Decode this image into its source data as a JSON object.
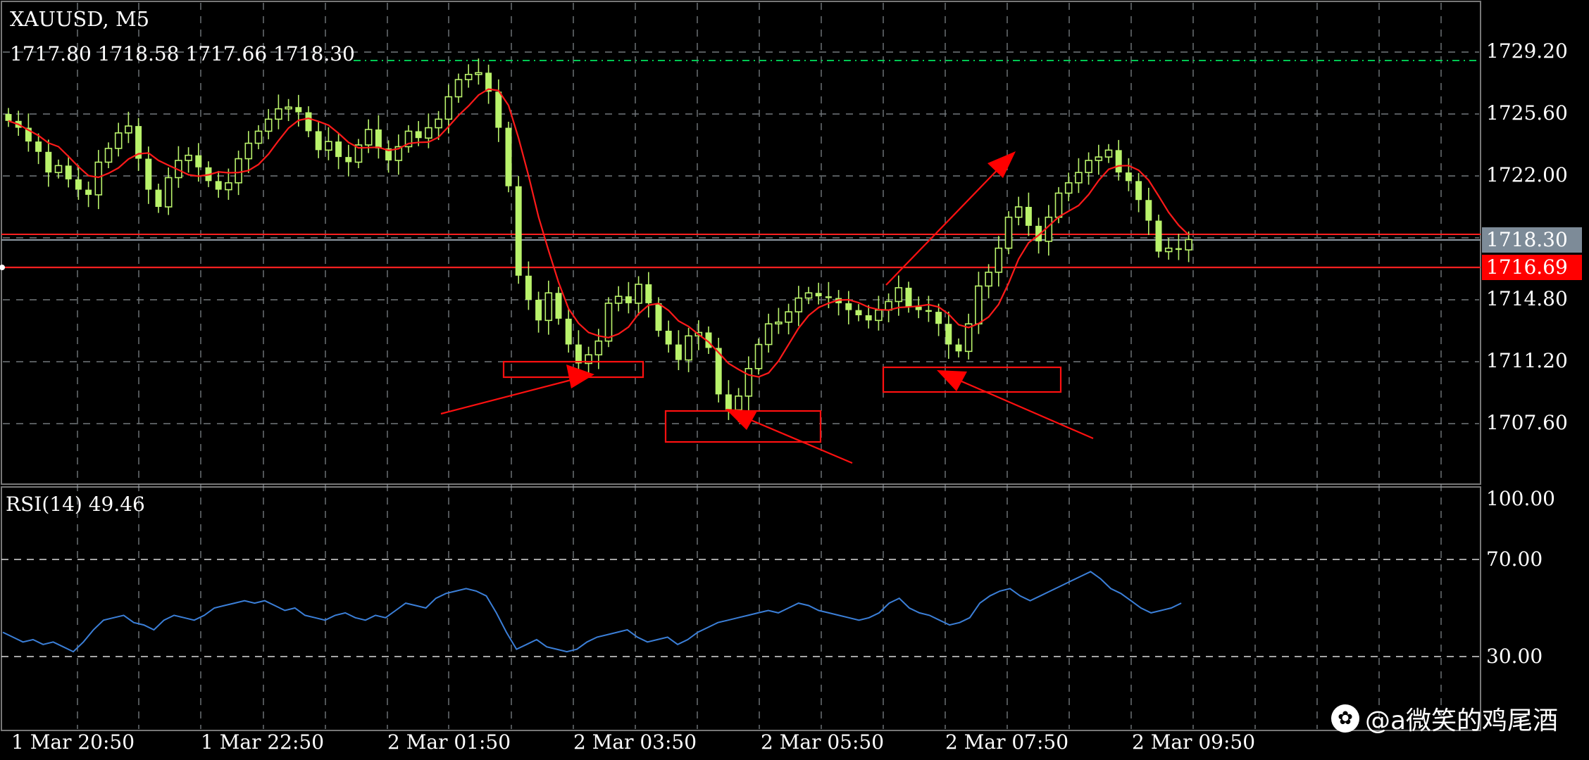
{
  "header": {
    "symbol": "XAUUSD, M5",
    "ohlc": "1717.80 1718.58 1717.66 1718.30"
  },
  "price_axis": {
    "ticks": [
      "1729.20",
      "1725.60",
      "1722.00",
      "1714.80",
      "1711.20",
      "1707.60"
    ],
    "current_price": "1718.30",
    "alert_price": "1716.69"
  },
  "rsi": {
    "title": "RSI(14) 49.46",
    "ticks": [
      "100.00",
      "70.00",
      "30.00"
    ]
  },
  "time_axis": {
    "ticks": [
      "1 Mar 20:50",
      "1 Mar 22:50",
      "2 Mar 01:50",
      "2 Mar 03:50",
      "2 Mar 05:50",
      "2 Mar 07:50",
      "2 Mar 09:50"
    ]
  },
  "watermark": "@a微笑的鸡尾酒",
  "colors": {
    "bull_candle": "#b9f26b",
    "bear_candle": "#b9f26b",
    "moving_average": "#ff1a1a",
    "rsi_line": "#3b7fd8",
    "grid": "#9aa0a6",
    "annotation": "#ff0000",
    "target_level": "#00c853"
  },
  "chart_data": {
    "type": "candlestick",
    "symbol": "XAUUSD",
    "timeframe": "M5",
    "price_levels": {
      "current": 1718.3,
      "alert": 1716.69,
      "target": 1729.2
    },
    "close_path": [
      1725.2,
      1724.8,
      1724.0,
      1723.4,
      1722.2,
      1722.6,
      1721.8,
      1721.2,
      1720.9,
      1722.8,
      1723.6,
      1724.5,
      1724.9,
      1723.0,
      1721.2,
      1720.2,
      1721.9,
      1722.9,
      1723.2,
      1722.5,
      1721.7,
      1721.2,
      1721.6,
      1723.0,
      1723.9,
      1724.6,
      1725.3,
      1725.9,
      1726.0,
      1725.7,
      1724.6,
      1723.5,
      1724.0,
      1723.1,
      1722.8,
      1723.8,
      1724.7,
      1723.6,
      1722.9,
      1723.7,
      1724.6,
      1724.2,
      1724.8,
      1725.3,
      1726.6,
      1727.6,
      1727.9,
      1728.0,
      1726.9,
      1724.8,
      1721.4,
      1716.2,
      1714.8,
      1713.6,
      1715.2,
      1713.7,
      1712.2,
      1711.1,
      1711.6,
      1712.4,
      1714.6,
      1715.0,
      1714.6,
      1715.7,
      1714.6,
      1713.0,
      1712.2,
      1711.3,
      1712.7,
      1712.9,
      1712.0,
      1709.3,
      1708.4,
      1709.2,
      1710.8,
      1712.2,
      1713.4,
      1713.5,
      1714.1,
      1714.9,
      1715.2,
      1715.0,
      1714.9,
      1714.6,
      1714.2,
      1713.9,
      1713.6,
      1714.2,
      1714.7,
      1715.5,
      1714.4,
      1714.2,
      1714.1,
      1713.4,
      1712.2,
      1711.8,
      1713.4,
      1715.6,
      1716.4,
      1717.8,
      1719.6,
      1720.2,
      1719.1,
      1718.2,
      1719.6,
      1721.0,
      1721.6,
      1722.2,
      1722.9,
      1723.1,
      1723.5,
      1722.2,
      1721.7,
      1720.6,
      1719.4,
      1717.6,
      1717.8,
      1717.7,
      1718.3
    ],
    "rsi_path": [
      40,
      38,
      36,
      37,
      35,
      36,
      34,
      32,
      36,
      41,
      45,
      46,
      47,
      44,
      43,
      41,
      45,
      47,
      46,
      45,
      47,
      50,
      51,
      52,
      53,
      52,
      53,
      51,
      49,
      50,
      47,
      46,
      45,
      47,
      48,
      46,
      45,
      47,
      46,
      49,
      52,
      51,
      50,
      54,
      56,
      57,
      58,
      57,
      55,
      48,
      40,
      33,
      35,
      37,
      34,
      33,
      32,
      33,
      36,
      38,
      39,
      40,
      41,
      38,
      36,
      37,
      38,
      35,
      37,
      40,
      42,
      44,
      45,
      46,
      47,
      48,
      49,
      48,
      50,
      52,
      51,
      49,
      48,
      47,
      46,
      45,
      46,
      48,
      52,
      54,
      50,
      48,
      47,
      45,
      43,
      44,
      46,
      52,
      55,
      57,
      58,
      55,
      53,
      55,
      57,
      59,
      61,
      63,
      65,
      62,
      58,
      56,
      53,
      50,
      48,
      49,
      50,
      52
    ],
    "rsi_levels": [
      70,
      30
    ],
    "annotations": [
      "support-box-1",
      "support-box-2",
      "support-box-3",
      "arrow-1",
      "arrow-2",
      "arrow-3",
      "arrow-up"
    ]
  }
}
